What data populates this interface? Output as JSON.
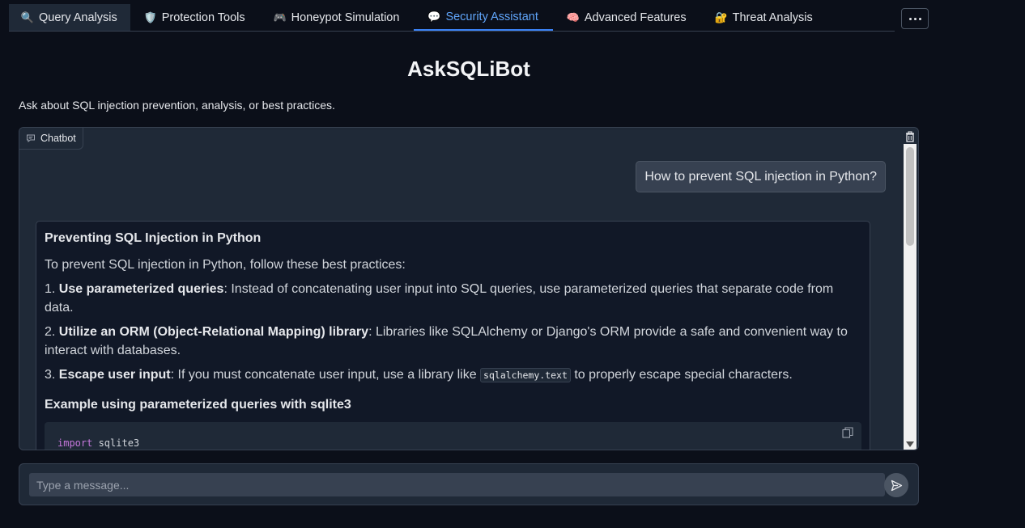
{
  "tabs": [
    {
      "icon": "🔍",
      "icon_name": "magnifier-icon",
      "label": "Query Analysis"
    },
    {
      "icon": "🛡️",
      "icon_name": "shield-icon",
      "label": "Protection Tools"
    },
    {
      "icon": "🎮",
      "icon_name": "game-controller-icon",
      "label": "Honeypot Simulation"
    },
    {
      "icon": "💬",
      "icon_name": "speech-bubble-icon",
      "label": "Security Assistant",
      "active": true
    },
    {
      "icon": "🧠",
      "icon_name": "brain-icon",
      "label": "Advanced Features"
    },
    {
      "icon": "🔐",
      "icon_name": "lock-icon",
      "label": "Threat Analysis"
    }
  ],
  "header": {
    "title": "AskSQLiBot",
    "description": "Ask about SQL injection prevention, analysis, or best practices."
  },
  "chatbot": {
    "label": "Chatbot",
    "user_message": "How to prevent SQL injection in Python?",
    "bot_message": {
      "heading": "Preventing SQL Injection in Python",
      "intro": "To prevent SQL injection in Python, follow these best practices:",
      "items": [
        {
          "num": "1.",
          "bold": "Use parameterized queries",
          "text": ": Instead of concatenating user input into SQL queries, use parameterized queries that separate code from data."
        },
        {
          "num": "2.",
          "bold": "Utilize an ORM (Object-Relational Mapping) library",
          "text": ": Libraries like SQLAlchemy or Django's ORM provide a safe and convenient way to interact with databases."
        },
        {
          "num": "3.",
          "bold": "Escape user input",
          "text_before": ": If you must concatenate user input, use a library like ",
          "code": "sqlalchemy.text",
          "text_after": " to properly escape special characters."
        }
      ],
      "example_heading": "Example using parameterized queries with sqlite3",
      "code_keyword": "import",
      "code_rest": " sqlite3"
    }
  },
  "input": {
    "placeholder": "Type a message..."
  },
  "colors": {
    "background": "#0b0f19",
    "panel": "#1f2937",
    "accent": "#3b82f6"
  }
}
